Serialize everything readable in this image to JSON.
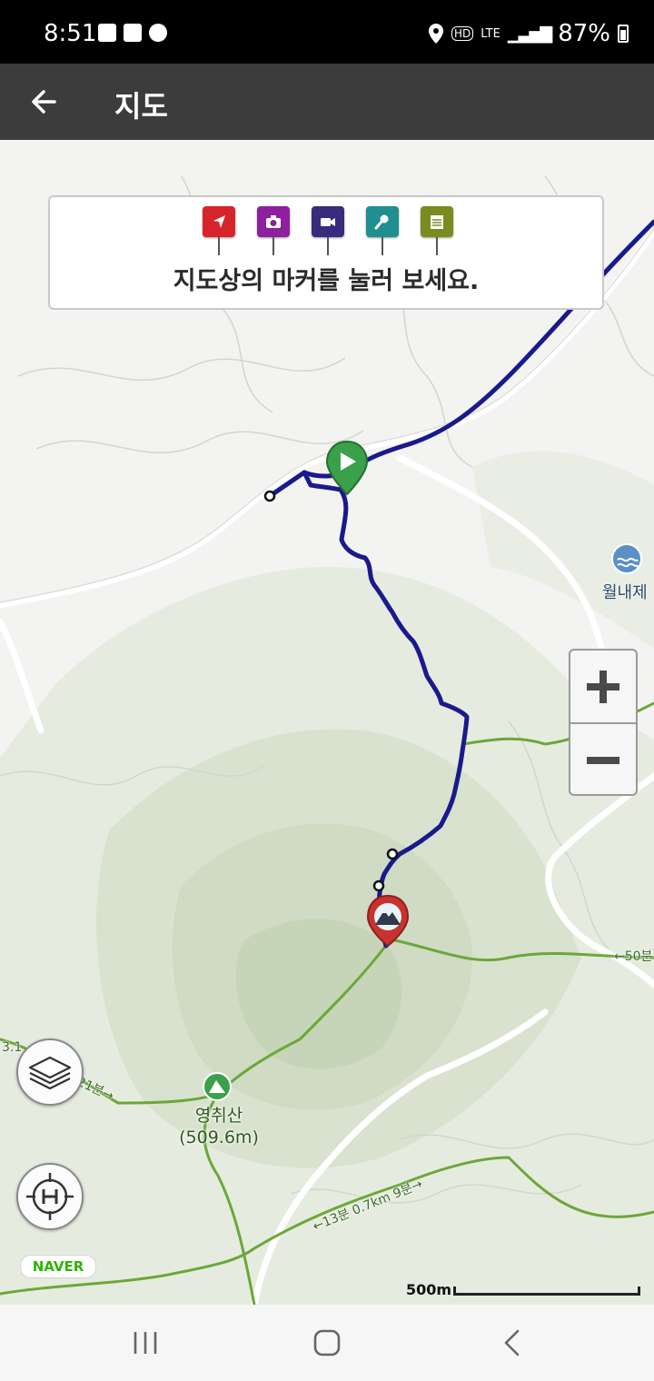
{
  "status_bar": {
    "time": "8:51",
    "network": "LTE",
    "battery": "87%"
  },
  "app_bar": {
    "title": "지도"
  },
  "legend": {
    "message": "지도상의 마커를 눌러 보세요.",
    "markers": [
      {
        "icon": "direction-flag-icon",
        "color": "#d7242b"
      },
      {
        "icon": "camera-icon",
        "color": "#8e1f9e"
      },
      {
        "icon": "video-icon",
        "color": "#3a2b7c"
      },
      {
        "icon": "microphone-icon",
        "color": "#1f8f8f"
      },
      {
        "icon": "memo-icon",
        "color": "#7a8b1f"
      }
    ]
  },
  "map": {
    "place_label": "월내제",
    "peak_name": "영취산",
    "peak_elevation": "(509.6m)",
    "trail_labels": [
      "←50분",
      "3.1",
      "21분→",
      "←13분 0.7km 9분→"
    ],
    "track_color": "#1a1a8c",
    "trail_color": "#6aa83a",
    "start_marker_icon": "play-icon",
    "summit_marker_icon": "mountain-summit-icon"
  },
  "zoom": {
    "in_icon": "plus-icon",
    "out_icon": "minus-icon"
  },
  "controls": {
    "layers_icon": "layers-icon",
    "home_icon": "helipad-crosshair-icon"
  },
  "attribution": {
    "logo": "NAVER"
  },
  "scale": {
    "label": "500m"
  },
  "nav_bar": {
    "recents_icon": "recents-icon",
    "home_icon": "home-icon",
    "back_icon": "back-icon"
  }
}
